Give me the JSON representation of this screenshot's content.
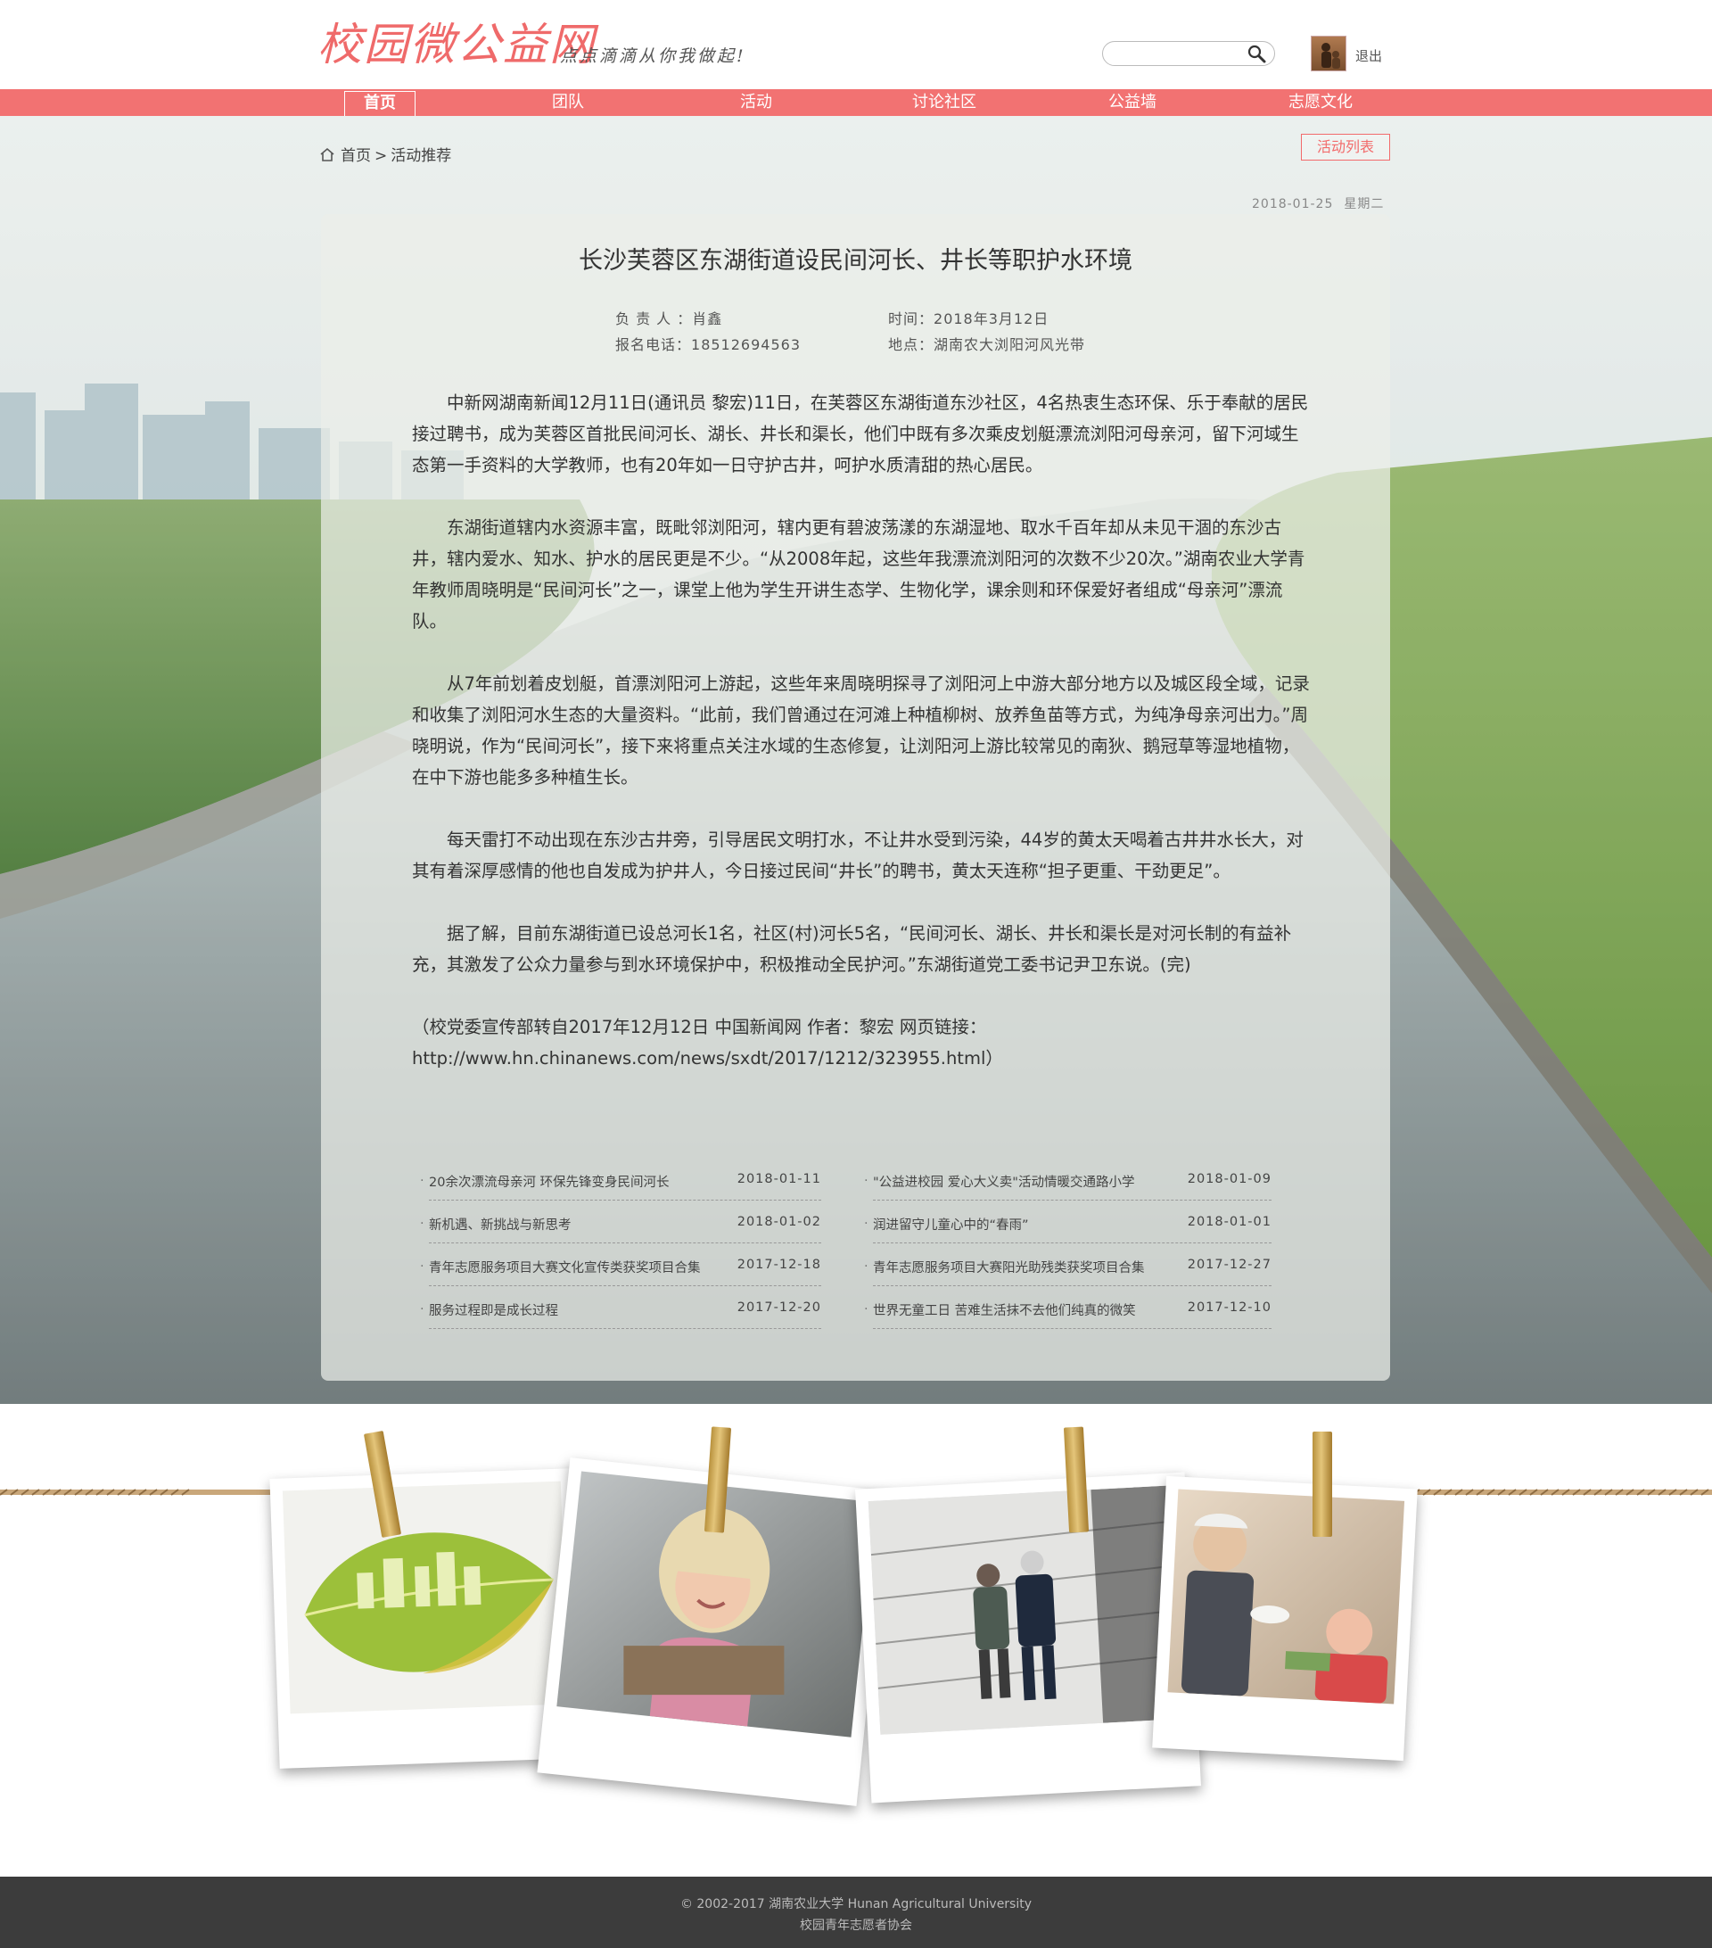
{
  "header": {
    "logo_text": "校园微公益网",
    "slogan": "点点滴滴从你我做起!",
    "search_placeholder": "",
    "logout_label": "退出"
  },
  "nav": {
    "items": [
      "首页",
      "团队",
      "活动",
      "讨论社区",
      "公益墙",
      "志愿文化"
    ],
    "active_index": 0
  },
  "breadcrumb": {
    "home": "首页",
    "separator": ">",
    "current": "活动推荐"
  },
  "activity_list_button": "活动列表",
  "date": {
    "value": "2018-01-25",
    "weekday": "星期二"
  },
  "article": {
    "title": "长沙芙蓉区东湖街道设民间河长、井长等职护水环境",
    "leader_label": "负 责 人 ：",
    "leader": "肖鑫",
    "phone_label": "报名电话：",
    "phone": "18512694563",
    "time_label": "时间：",
    "time": "2018年3月12日",
    "location_label": "地点：",
    "location": "湖南农大浏阳河风光带",
    "paragraphs": [
      "　　中新网湖南新闻12月11日(通讯员 黎宏)11日，在芙蓉区东湖街道东沙社区，4名热衷生态环保、乐于奉献的居民接过聘书，成为芙蓉区首批民间河长、湖长、井长和渠长，他们中既有多次乘皮划艇漂流浏阳河母亲河，留下河域生态第一手资料的大学教师，也有20年如一日守护古井，呵护水质清甜的热心居民。",
      "　　东湖街道辖内水资源丰富，既毗邻浏阳河，辖内更有碧波荡漾的东湖湿地、取水千百年却从未见干涸的东沙古井，辖内爱水、知水、护水的居民更是不少。“从2008年起，这些年我漂流浏阳河的次数不少20次。”湖南农业大学青年教师周晓明是“民间河长”之一，课堂上他为学生开讲生态学、生物化学，课余则和环保爱好者组成“母亲河”漂流队。",
      "　　从7年前划着皮划艇，首漂浏阳河上游起，这些年来周晓明探寻了浏阳河上中游大部分地方以及城区段全域，记录和收集了浏阳河水生态的大量资料。“此前，我们曾通过在河滩上种植柳树、放养鱼苗等方式，为纯净母亲河出力。”周晓明说，作为“民间河长”，接下来将重点关注水域的生态修复，让浏阳河上游比较常见的南狄、鹅冠草等湿地植物，在中下游也能多多种植生长。",
      "　　每天雷打不动出现在东沙古井旁，引导居民文明打水，不让井水受到污染，44岁的黄太天喝着古井井水长大，对其有着深厚感情的他也自发成为护井人，今日接过民间“井长”的聘书，黄太天连称“担子更重、干劲更足”。",
      "　　据了解，目前东湖街道已设总河长1名，社区(村)河长5名，“民间河长、湖长、井长和渠长是对河长制的有益补充，其激发了公众力量参与到水环境保护中，积极推动全民护河。”东湖街道党工委书记尹卫东说。(完)",
      "（校党委宣传部转自2017年12月12日 中国新闻网 作者：黎宏 网页链接：http://www.hn.chinanews.com/news/sxdt/2017/1212/323955.html）"
    ]
  },
  "related": [
    {
      "title": "20余次漂流母亲河 环保先锋变身民间河长",
      "date": "2018-01-11"
    },
    {
      "title": "\"公益进校园 爱心大义卖\"活动情暖交通路小学",
      "date": "2018-01-09"
    },
    {
      "title": "新机遇、新挑战与新思考",
      "date": "2018-01-02"
    },
    {
      "title": "润进留守儿童心中的“春雨”",
      "date": "2018-01-01"
    },
    {
      "title": "青年志愿服务项目大赛文化宣传类获奖项目合集",
      "date": "2017-12-18"
    },
    {
      "title": "青年志愿服务项目大赛阳光助残类获奖项目合集",
      "date": "2017-12-27"
    },
    {
      "title": "服务过程即是成长过程",
      "date": "2017-12-20"
    },
    {
      "title": "世界无童工日 苦难生活抹不去他们纯真的微笑",
      "date": "2017-12-10"
    }
  ],
  "photos": [
    "leaf-photo",
    "crying-child-photo",
    "elderly-couple-photo",
    "grandparent-baby-photo"
  ],
  "footer": {
    "copyright": "© 2002-2017 湖南农业大学 Hunan Agricultural University",
    "org": "校园青年志愿者协会"
  },
  "colors": {
    "accent": "#f27272",
    "footer_bg": "#3c3c3c"
  }
}
